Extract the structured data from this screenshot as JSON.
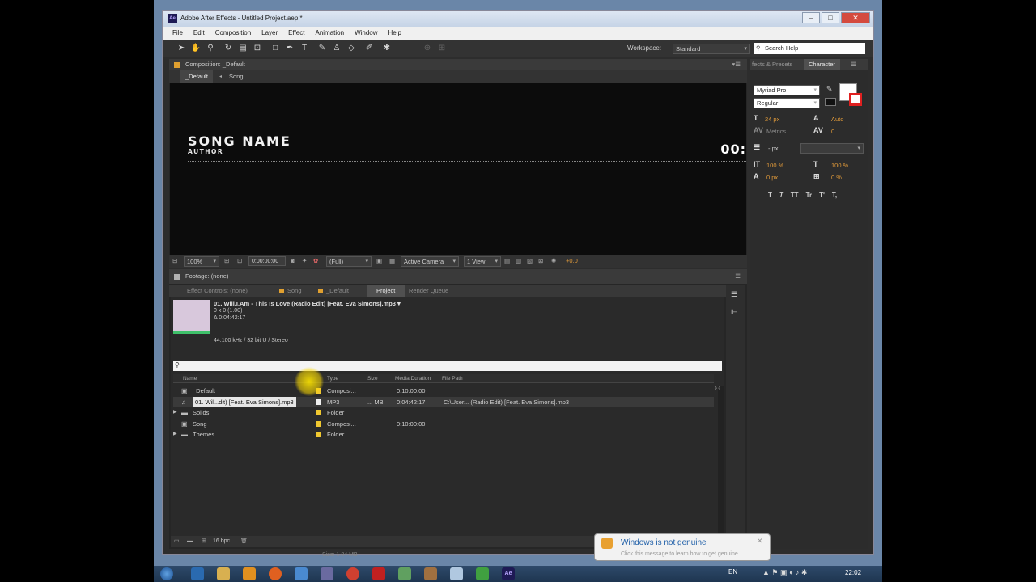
{
  "window": {
    "title": "Adobe After Effects - Untitled Project.aep *",
    "app_icon": "Ae"
  },
  "menu": [
    "File",
    "Edit",
    "Composition",
    "Layer",
    "Effect",
    "Animation",
    "Window",
    "Help"
  ],
  "toolbar": {
    "workspace_label": "Workspace:",
    "workspace_value": "Standard",
    "search_help": "Search Help"
  },
  "composition_panel": {
    "header": "Composition: _Default",
    "flow": [
      "_Default",
      "Song"
    ],
    "viewer": {
      "song_name": "SONG NAME",
      "author": "AUTHOR",
      "timer": "00:"
    },
    "bar": {
      "zoom": "100%",
      "timecode": "0:00:00:00",
      "resolution": "(Full)",
      "camera": "Active Camera",
      "views": "1 View",
      "exposure": "+0.0"
    }
  },
  "footage_panel": {
    "header": "Footage: (none)",
    "tabs": [
      "Effect Controls: (none)",
      "Song",
      "_Default",
      "Project",
      "Render Queue"
    ],
    "active_tab": "Project"
  },
  "project": {
    "selected_title": "01. Will.I.Am - This Is Love (Radio Edit) [Feat. Eva Simons].mp3 ▾",
    "info_dims": "0 x 0 (1.00)",
    "info_duration": "Δ 0:04:42:17",
    "info_audio": "44.100 kHz / 32 bit U / Stereo",
    "columns": [
      "Name",
      "Type",
      "Size",
      "Media Duration",
      "File Path"
    ],
    "items": [
      {
        "name": "_Default",
        "type": "Composi...",
        "size": "",
        "duration": "0:10:00:00",
        "path": "",
        "icon": "composition-icon",
        "expandable": false,
        "label_color": "#f0c830",
        "selected": false
      },
      {
        "name": "01. Wil...dit) [Feat. Eva Simons].mp3",
        "type": "MP3",
        "size": "... MB",
        "duration": "0:04:42:17",
        "path": "C:\\User... (Radio Edit) [Feat. Eva Simons].mp3",
        "icon": "audio-file-icon",
        "expandable": false,
        "label_color": "#f0f0f0",
        "selected": true
      },
      {
        "name": "Solids",
        "type": "Folder",
        "size": "",
        "duration": "",
        "path": "",
        "icon": "folder-icon",
        "expandable": true,
        "label_color": "#f0c830",
        "selected": false
      },
      {
        "name": "Song",
        "type": "Composi...",
        "size": "",
        "duration": "0:10:00:00",
        "path": "",
        "icon": "composition-icon",
        "expandable": false,
        "label_color": "#f0c830",
        "selected": false
      },
      {
        "name": "Themes",
        "type": "Folder",
        "size": "",
        "duration": "",
        "path": "",
        "icon": "folder-icon",
        "expandable": true,
        "label_color": "#f0c830",
        "selected": false
      }
    ],
    "footer_bpc": "16 bpc",
    "footer_size": "Size: 1.84 MB"
  },
  "character_panel": {
    "tabs": [
      "fects & Presets",
      "Character"
    ],
    "font": "Myriad Pro",
    "style": "Regular",
    "font_size": "24 px",
    "leading": "Auto",
    "kerning": "Metrics",
    "tracking": "0",
    "stroke_unit": "- px",
    "vscale": "100 %",
    "hscale": "100 %",
    "baseline": "0 px",
    "tsume": "0 %",
    "styles": [
      "T",
      "T",
      "TT",
      "Tr",
      "T'",
      "T,"
    ]
  },
  "notice": {
    "title": "Windows is not genuine",
    "body": "Click this message to learn how to get genuine"
  },
  "taskbar": {
    "lang": "EN",
    "time": "22:02"
  }
}
